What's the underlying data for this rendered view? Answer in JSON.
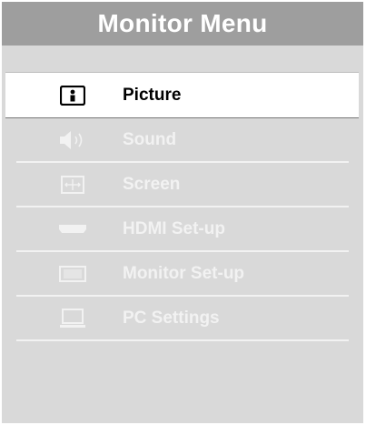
{
  "title": "Monitor Menu",
  "menu": {
    "items": [
      {
        "label": "Picture",
        "icon": "picture-icon",
        "selected": true
      },
      {
        "label": "Sound",
        "icon": "speaker-icon",
        "selected": false
      },
      {
        "label": "Screen",
        "icon": "screen-resize-icon",
        "selected": false
      },
      {
        "label": "HDMI Set-up",
        "icon": "hdmi-connector-icon",
        "selected": false
      },
      {
        "label": "Monitor Set-up",
        "icon": "monitor-icon",
        "selected": false
      },
      {
        "label": "PC Settings",
        "icon": "laptop-icon",
        "selected": false
      }
    ]
  },
  "colors": {
    "panel": "#d9d9d9",
    "title_bar": "#9e9e9e",
    "item_text": "#f2f2f2",
    "selected_bg": "#ffffff",
    "selected_text": "#000000"
  }
}
